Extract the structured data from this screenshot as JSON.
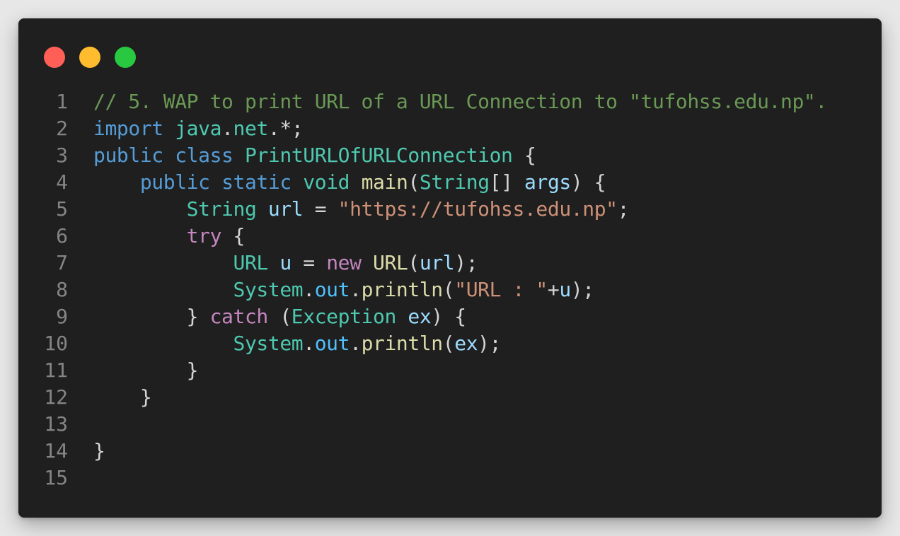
{
  "window": {
    "controls": [
      {
        "name": "close-button",
        "color": "#ff5f57"
      },
      {
        "name": "minimize-button",
        "color": "#febc2e"
      },
      {
        "name": "maximize-button",
        "color": "#28c840"
      }
    ]
  },
  "colors": {
    "comment": "#6a9955",
    "keyword": "#569cd6",
    "control": "#c586c0",
    "type": "#4ec9b0",
    "function": "#dcdcaa",
    "variable": "#9cdcfe",
    "field": "#4fc1ff",
    "string": "#ce9178",
    "plain": "#d4d4d4"
  },
  "lines": [
    {
      "n": "1",
      "t": [
        [
          "comment",
          "// 5. WAP to print URL of a URL Connection to \"tufohss.edu.np\"."
        ]
      ]
    },
    {
      "n": "2",
      "t": [
        [
          "keyword",
          "import"
        ],
        [
          "plain",
          " "
        ],
        [
          "type",
          "java"
        ],
        [
          "plain",
          "."
        ],
        [
          "type",
          "net"
        ],
        [
          "plain",
          ".*;"
        ]
      ]
    },
    {
      "n": "3",
      "t": [
        [
          "keyword",
          "public"
        ],
        [
          "plain",
          " "
        ],
        [
          "keyword",
          "class"
        ],
        [
          "plain",
          " "
        ],
        [
          "type",
          "PrintURLOfURLConnection"
        ],
        [
          "plain",
          " {"
        ]
      ]
    },
    {
      "n": "4",
      "t": [
        [
          "plain",
          "    "
        ],
        [
          "keyword",
          "public"
        ],
        [
          "plain",
          " "
        ],
        [
          "keyword",
          "static"
        ],
        [
          "plain",
          " "
        ],
        [
          "type",
          "void"
        ],
        [
          "plain",
          " "
        ],
        [
          "function",
          "main"
        ],
        [
          "plain",
          "("
        ],
        [
          "type",
          "String"
        ],
        [
          "plain",
          "[] "
        ],
        [
          "variable",
          "args"
        ],
        [
          "plain",
          ") {"
        ]
      ]
    },
    {
      "n": "5",
      "t": [
        [
          "plain",
          "        "
        ],
        [
          "type",
          "String"
        ],
        [
          "plain",
          " "
        ],
        [
          "variable",
          "url"
        ],
        [
          "plain",
          " = "
        ],
        [
          "string",
          "\"https://tufohss.edu.np\""
        ],
        [
          "plain",
          ";"
        ]
      ]
    },
    {
      "n": "6",
      "t": [
        [
          "plain",
          "        "
        ],
        [
          "control",
          "try"
        ],
        [
          "plain",
          " {"
        ]
      ]
    },
    {
      "n": "7",
      "t": [
        [
          "plain",
          "            "
        ],
        [
          "type",
          "URL"
        ],
        [
          "plain",
          " "
        ],
        [
          "variable",
          "u"
        ],
        [
          "plain",
          " = "
        ],
        [
          "control",
          "new"
        ],
        [
          "plain",
          " "
        ],
        [
          "function",
          "URL"
        ],
        [
          "plain",
          "("
        ],
        [
          "variable",
          "url"
        ],
        [
          "plain",
          ");"
        ]
      ]
    },
    {
      "n": "8",
      "t": [
        [
          "plain",
          "            "
        ],
        [
          "type",
          "System"
        ],
        [
          "plain",
          "."
        ],
        [
          "field",
          "out"
        ],
        [
          "plain",
          "."
        ],
        [
          "function",
          "println"
        ],
        [
          "plain",
          "("
        ],
        [
          "string",
          "\"URL : \""
        ],
        [
          "plain",
          "+"
        ],
        [
          "variable",
          "u"
        ],
        [
          "plain",
          ");"
        ]
      ]
    },
    {
      "n": "9",
      "t": [
        [
          "plain",
          "        } "
        ],
        [
          "control",
          "catch"
        ],
        [
          "plain",
          " ("
        ],
        [
          "type",
          "Exception"
        ],
        [
          "plain",
          " "
        ],
        [
          "variable",
          "ex"
        ],
        [
          "plain",
          ") {"
        ]
      ]
    },
    {
      "n": "10",
      "t": [
        [
          "plain",
          "            "
        ],
        [
          "type",
          "System"
        ],
        [
          "plain",
          "."
        ],
        [
          "field",
          "out"
        ],
        [
          "plain",
          "."
        ],
        [
          "function",
          "println"
        ],
        [
          "plain",
          "("
        ],
        [
          "variable",
          "ex"
        ],
        [
          "plain",
          ");"
        ]
      ]
    },
    {
      "n": "11",
      "t": [
        [
          "plain",
          "        }"
        ]
      ]
    },
    {
      "n": "12",
      "t": [
        [
          "plain",
          "    }"
        ]
      ]
    },
    {
      "n": "13",
      "t": []
    },
    {
      "n": "14",
      "t": [
        [
          "plain",
          "}"
        ]
      ]
    },
    {
      "n": "15",
      "t": []
    }
  ]
}
